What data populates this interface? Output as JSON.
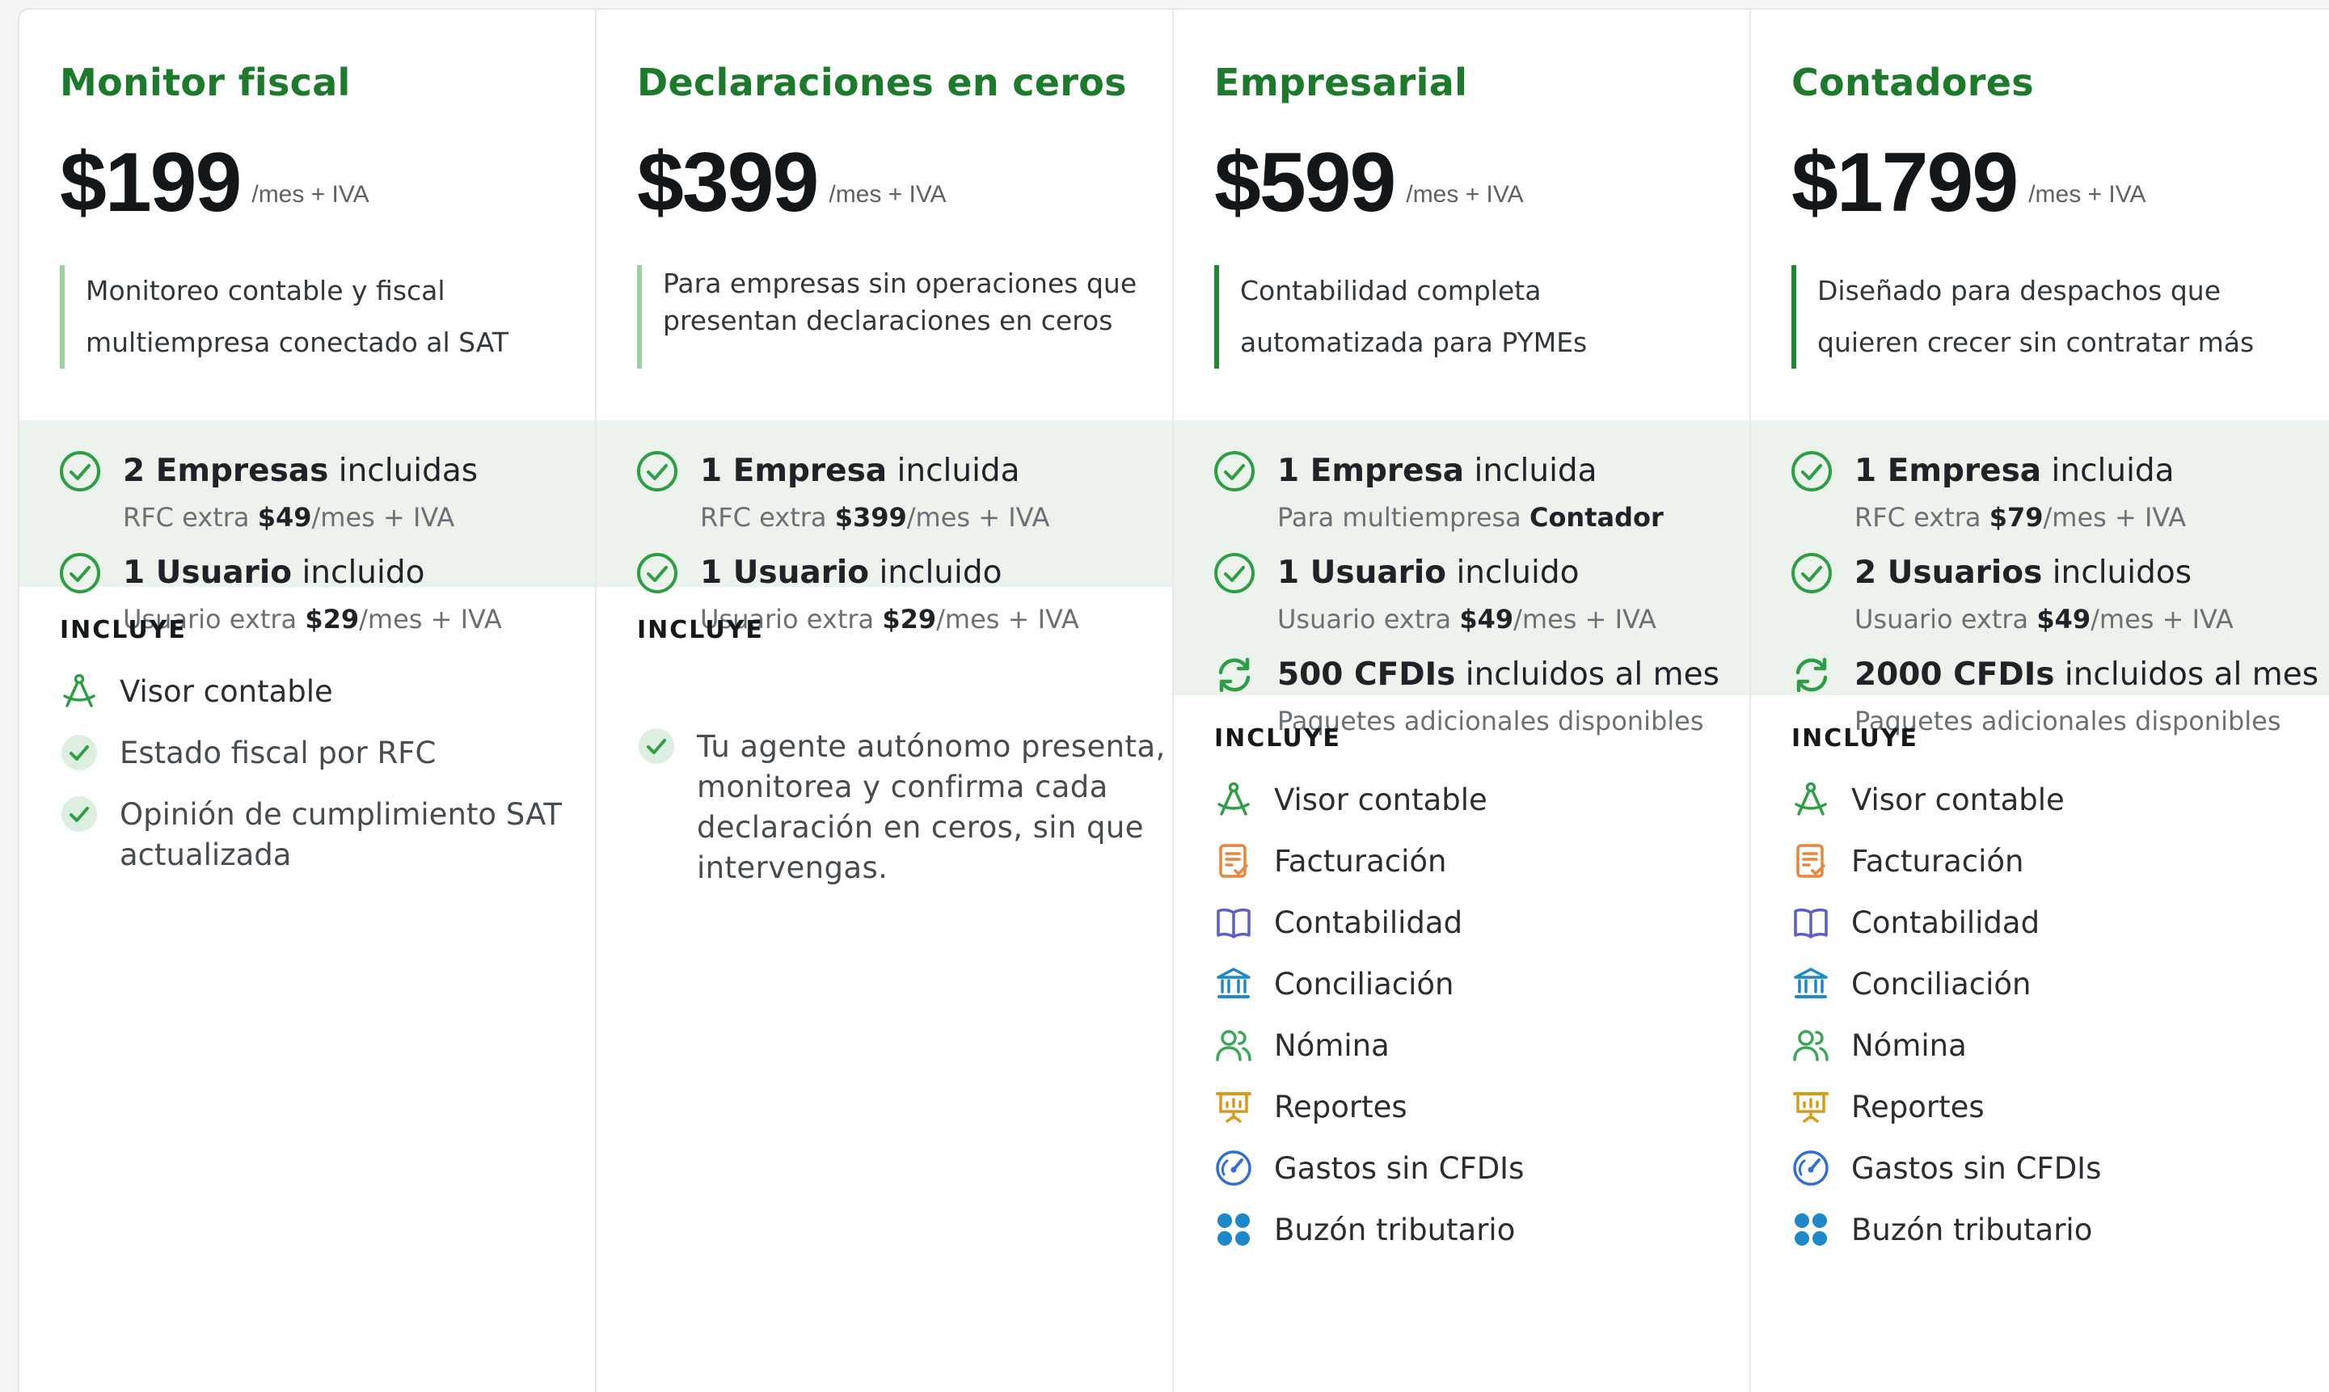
{
  "plans": [
    {
      "name": "Monitor fiscal",
      "price": "$199",
      "period": "/mes + IVA",
      "description": "Monitoreo contable y fiscal multiempresa conectado al SAT",
      "features": [
        {
          "icon": "check-circle-icon",
          "title_bold": "2 Empresas",
          "title_rest": " incluidas",
          "sub_pre": "RFC extra ",
          "sub_bold": "$49",
          "sub_post": "/mes + IVA"
        },
        {
          "icon": "check-circle-icon",
          "title_bold": "1 Usuario",
          "title_rest": " incluido",
          "sub_pre": "Usuario extra ",
          "sub_bold": "$29",
          "sub_post": "/mes + IVA"
        }
      ],
      "includes_heading": "INCLUYE",
      "includes": [
        {
          "icon": "compass-icon",
          "label": "Visor contable"
        },
        {
          "icon": "check-badge-icon",
          "label": "Estado fiscal por RFC"
        },
        {
          "icon": "check-badge-icon",
          "label": "Opinión de cumplimiento SAT actualizada"
        }
      ]
    },
    {
      "name": "Declaraciones en ceros",
      "price": "$399",
      "period": "/mes + IVA",
      "description": "Para empresas sin operaciones que presentan declaraciones en ceros",
      "features": [
        {
          "icon": "check-circle-icon",
          "title_bold": "1 Empresa",
          "title_rest": " incluida",
          "sub_pre": "RFC extra ",
          "sub_bold": "$399",
          "sub_post": "/mes + IVA"
        },
        {
          "icon": "check-circle-icon",
          "title_bold": "1 Usuario",
          "title_rest": " incluido",
          "sub_pre": "Usuario extra ",
          "sub_bold": "$29",
          "sub_post": "/mes + IVA"
        }
      ],
      "includes_heading": "INCLUYE",
      "includes_text": "Tu agente autónomo presenta, monitorea y confirma cada declaración en ceros, sin que intervengas."
    },
    {
      "name": "Empresarial",
      "price": "$599",
      "period": "/mes + IVA",
      "description": "Contabilidad completa automatizada para PYMEs",
      "features": [
        {
          "icon": "check-circle-icon",
          "title_bold": "1 Empresa",
          "title_rest": " incluida",
          "sub_pre": "Para multiempresa ",
          "sub_bold": "Contador",
          "sub_post": ""
        },
        {
          "icon": "check-circle-icon",
          "title_bold": "1 Usuario",
          "title_rest": " incluido",
          "sub_pre": "Usuario extra ",
          "sub_bold": "$49",
          "sub_post": "/mes + IVA"
        },
        {
          "icon": "refresh-icon",
          "title_bold": "500 CFDIs",
          "title_rest": " incluidos al mes",
          "sub_pre": "Paquetes adicionales disponibles",
          "sub_bold": "",
          "sub_post": ""
        }
      ],
      "includes_heading": "INCLUYE",
      "includes": [
        {
          "icon": "compass-icon",
          "label": "Visor contable"
        },
        {
          "icon": "invoice-icon",
          "label": "Facturación"
        },
        {
          "icon": "book-icon",
          "label": "Contabilidad"
        },
        {
          "icon": "bank-icon",
          "label": "Conciliación"
        },
        {
          "icon": "users-icon",
          "label": "Nómina"
        },
        {
          "icon": "presentation-icon",
          "label": "Reportes"
        },
        {
          "icon": "gauge-icon",
          "label": "Gastos sin CFDIs"
        },
        {
          "icon": "grid-dots-icon",
          "label": "Buzón tributario"
        }
      ]
    },
    {
      "name": "Contadores",
      "price": "$1799",
      "period": "/mes + IVA",
      "description": "Diseñado para despachos que quieren crecer sin contratar más",
      "features": [
        {
          "icon": "check-circle-icon",
          "title_bold": "1 Empresa",
          "title_rest": " incluida",
          "sub_pre": "RFC extra ",
          "sub_bold": "$79",
          "sub_post": "/mes + IVA"
        },
        {
          "icon": "check-circle-icon",
          "title_bold": "2 Usuarios",
          "title_rest": " incluidos",
          "sub_pre": "Usuario extra ",
          "sub_bold": "$49",
          "sub_post": "/mes + IVA"
        },
        {
          "icon": "refresh-icon",
          "title_bold": "2000 CFDIs",
          "title_rest": " incluidos al mes",
          "sub_pre": "Paquetes adicionales disponibles",
          "sub_bold": "",
          "sub_post": ""
        }
      ],
      "includes_heading": "INCLUYE",
      "includes": [
        {
          "icon": "compass-icon",
          "label": "Visor contable"
        },
        {
          "icon": "invoice-icon",
          "label": "Facturación"
        },
        {
          "icon": "book-icon",
          "label": "Contabilidad"
        },
        {
          "icon": "bank-icon",
          "label": "Conciliación"
        },
        {
          "icon": "users-icon",
          "label": "Nómina"
        },
        {
          "icon": "presentation-icon",
          "label": "Reportes"
        },
        {
          "icon": "gauge-icon",
          "label": "Gastos sin CFDIs"
        },
        {
          "icon": "grid-dots-icon",
          "label": "Buzón tributario"
        }
      ]
    }
  ],
  "colors": {
    "brand_green": "#1d7a2c",
    "feature_band": "#ebf3ec",
    "accent_light": "#9fd1a3",
    "accent_dark": "#1d8a33"
  }
}
